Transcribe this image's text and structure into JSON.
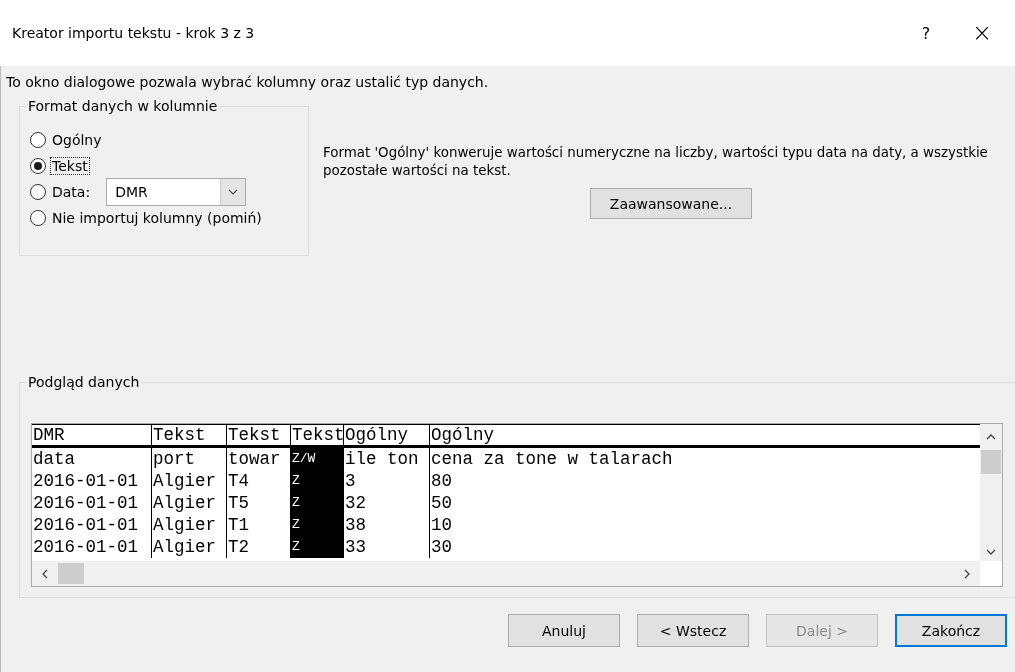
{
  "window": {
    "title": "Kreator importu tekstu - krok 3 z 3",
    "help": "?",
    "close": "×"
  },
  "description": "To okno dialogowe pozwala wybrać kolumny oraz ustalić typ danych.",
  "format_group": {
    "title": "Format danych w kolumnie",
    "options": [
      {
        "label": "Ogólny",
        "selected": false,
        "kind": "plain"
      },
      {
        "label": "Tekst",
        "selected": true,
        "kind": "plain"
      },
      {
        "label": "Data:",
        "selected": false,
        "kind": "date"
      },
      {
        "label": "Nie importuj kolumny (pomiń)",
        "selected": false,
        "kind": "plain"
      }
    ],
    "date_format": "DMR"
  },
  "info": "Format 'Ogólny' konweruje wartości numeryczne na liczby, wartości typu data na daty, a wszystkie pozostałe wartości na tekst.",
  "advanced_button": "Zaawansowane...",
  "preview": {
    "title": "Podgląd danych",
    "columns": [
      {
        "type": "DMR",
        "selected": false
      },
      {
        "type": "Tekst",
        "selected": false
      },
      {
        "type": "Tekst",
        "selected": false
      },
      {
        "type": "Tekst",
        "selected": true
      },
      {
        "type": "Ogólny",
        "selected": false
      },
      {
        "type": "Ogólny",
        "selected": false
      }
    ],
    "rows": [
      [
        "data",
        "port",
        "towar",
        "Z/W",
        "ile ton",
        "cena za tone w talarach"
      ],
      [
        "2016-01-01",
        "Algier",
        "T4",
        "Z",
        "3",
        "80"
      ],
      [
        "2016-01-01",
        "Algier",
        "T5",
        "Z",
        "32",
        "50"
      ],
      [
        "2016-01-01",
        "Algier",
        "T1",
        "Z",
        "38",
        "10"
      ],
      [
        "2016-01-01",
        "Algier",
        "T2",
        "Z",
        "33",
        "30"
      ]
    ]
  },
  "buttons": [
    {
      "label": "Anuluj",
      "disabled": false,
      "default": false
    },
    {
      "label": "< Wstecz",
      "disabled": false,
      "default": false
    },
    {
      "label": "Dalej >",
      "disabled": true,
      "default": false
    },
    {
      "label": "Zakończ",
      "disabled": false,
      "default": true
    }
  ]
}
